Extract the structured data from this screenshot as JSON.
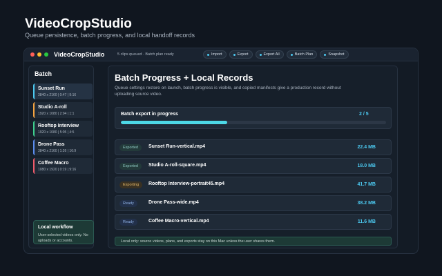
{
  "hero": {
    "title": "VideoCropStudio",
    "subtitle": "Queue persistence, batch progress, and local handoff records"
  },
  "window": {
    "app_name": "VideoCropStudio",
    "status": "5 clips queued · Batch plan ready",
    "toolbar": [
      {
        "label": "Import",
        "icon": "dot-icon"
      },
      {
        "label": "Export",
        "icon": "dot-icon"
      },
      {
        "label": "Export All",
        "icon": "dot-icon"
      },
      {
        "label": "Batch Plan",
        "icon": "dot-icon"
      },
      {
        "label": "Snapshot",
        "icon": "dot-icon"
      }
    ]
  },
  "sidebar": {
    "title": "Batch",
    "clips": [
      {
        "name": "Sunset Run",
        "meta": "3840 x 2160 | 0:47 | 9:16",
        "color": "#4cc9f0"
      },
      {
        "name": "Studio A-roll",
        "meta": "1920 x 1080 | 2:04 | 1:1",
        "color": "#f4a340"
      },
      {
        "name": "Rooftop Interview",
        "meta": "1920 x 1080 | 5:05 | 4:5",
        "color": "#3ecf8e"
      },
      {
        "name": "Drone Pass",
        "meta": "3840 x 2160 | 1:26 | 16:9",
        "color": "#5b8def"
      },
      {
        "name": "Coffee Macro",
        "meta": "1080 x 1920 | 0:19 | 9:16",
        "color": "#ef5b6a"
      }
    ],
    "local": {
      "title": "Local workflow",
      "text": "User-selected videos only. No uploads or accounts."
    }
  },
  "main": {
    "title": "Batch Progress + Local Records",
    "description": "Queue settings restore on launch, batch progress is visible, and copied manifests give a production record without uploading source video.",
    "progress": {
      "label": "Batch export in progress",
      "count": "2 / 5",
      "fraction": 0.4
    },
    "records": [
      {
        "status": "Exported",
        "kind": "exported",
        "file": "Sunset Run-vertical.mp4",
        "size": "22.4 MB"
      },
      {
        "status": "Exported",
        "kind": "exported",
        "file": "Studio A-roll-square.mp4",
        "size": "18.0 MB"
      },
      {
        "status": "Exporting",
        "kind": "exporting",
        "file": "Rooftop Interview-portrait45.mp4",
        "size": "41.7 MB"
      },
      {
        "status": "Ready",
        "kind": "ready",
        "file": "Drone Pass-wide.mp4",
        "size": "38.2 MB"
      },
      {
        "status": "Ready",
        "kind": "ready",
        "file": "Coffee Macro-vertical.mp4",
        "size": "11.6 MB"
      }
    ],
    "footer_note": "Local only: source videos, plans, and exports stay on this Mac unless the user shares them."
  }
}
